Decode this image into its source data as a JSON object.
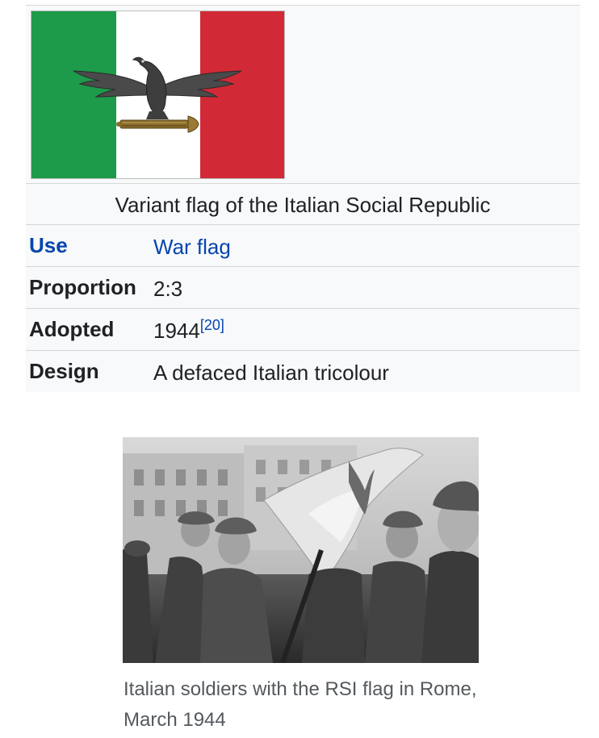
{
  "infobox": {
    "flag_caption": "Variant flag of the Italian Social Republic",
    "flag_colors": {
      "green": "#1d9a4a",
      "white": "#ffffff",
      "red": "#d12a36"
    },
    "rows": [
      {
        "label": "Use",
        "value": "War flag",
        "label_is_link": true,
        "value_is_link": true
      },
      {
        "label": "Proportion",
        "value": "2:3"
      },
      {
        "label": "Adopted",
        "value": "1944",
        "ref": "[20]"
      },
      {
        "label": "Design",
        "value": "A defaced Italian tricolour"
      }
    ]
  },
  "photo": {
    "caption": "Italian soldiers with the RSI flag in Rome, March 1944"
  }
}
